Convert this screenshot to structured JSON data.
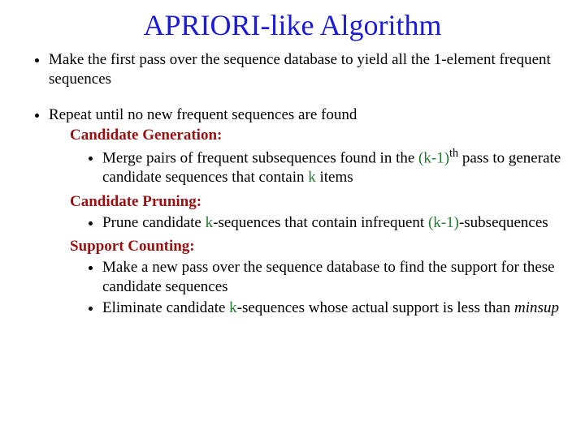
{
  "title": "APRIORI-like Algorithm",
  "bullet1": "Make the first pass over the sequence database to yield all the 1-element frequent sequences",
  "bullet2_head": "Repeat until no new frequent sequences are found",
  "candGen": {
    "head": "Candidate Generation:",
    "p1_a": "Merge pairs of frequent subsequences found in the ",
    "p1_k": "(k-1)",
    "p1_th": "th",
    "p1_b": " pass to generate candidate sequences that contain ",
    "p1_kitems": "k",
    "p1_c": " items"
  },
  "candPrune": {
    "head": "Candidate Pruning:",
    "p1_a": "Prune candidate ",
    "p1_k": "k",
    "p1_b": "-sequences that contain infrequent ",
    "p1_km1": "(k-1)",
    "p1_c": "-subsequences"
  },
  "supCount": {
    "head": "Support Counting:",
    "p1": "Make a new pass over the sequence database to find the support for these candidate sequences",
    "p2_a": "Eliminate candidate ",
    "p2_k": "k",
    "p2_b": "-sequences whose actual support is less than ",
    "p2_minsup": "minsup"
  }
}
